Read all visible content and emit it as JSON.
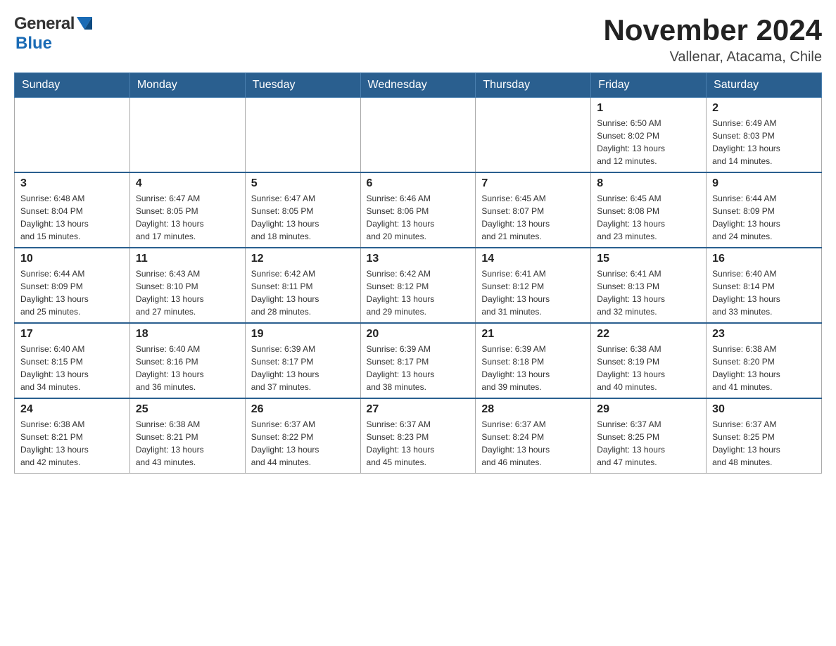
{
  "header": {
    "logo_general": "General",
    "logo_blue": "Blue",
    "title": "November 2024",
    "subtitle": "Vallenar, Atacama, Chile"
  },
  "weekdays": [
    "Sunday",
    "Monday",
    "Tuesday",
    "Wednesday",
    "Thursday",
    "Friday",
    "Saturday"
  ],
  "weeks": [
    [
      {
        "day": "",
        "info": ""
      },
      {
        "day": "",
        "info": ""
      },
      {
        "day": "",
        "info": ""
      },
      {
        "day": "",
        "info": ""
      },
      {
        "day": "",
        "info": ""
      },
      {
        "day": "1",
        "info": "Sunrise: 6:50 AM\nSunset: 8:02 PM\nDaylight: 13 hours\nand 12 minutes."
      },
      {
        "day": "2",
        "info": "Sunrise: 6:49 AM\nSunset: 8:03 PM\nDaylight: 13 hours\nand 14 minutes."
      }
    ],
    [
      {
        "day": "3",
        "info": "Sunrise: 6:48 AM\nSunset: 8:04 PM\nDaylight: 13 hours\nand 15 minutes."
      },
      {
        "day": "4",
        "info": "Sunrise: 6:47 AM\nSunset: 8:05 PM\nDaylight: 13 hours\nand 17 minutes."
      },
      {
        "day": "5",
        "info": "Sunrise: 6:47 AM\nSunset: 8:05 PM\nDaylight: 13 hours\nand 18 minutes."
      },
      {
        "day": "6",
        "info": "Sunrise: 6:46 AM\nSunset: 8:06 PM\nDaylight: 13 hours\nand 20 minutes."
      },
      {
        "day": "7",
        "info": "Sunrise: 6:45 AM\nSunset: 8:07 PM\nDaylight: 13 hours\nand 21 minutes."
      },
      {
        "day": "8",
        "info": "Sunrise: 6:45 AM\nSunset: 8:08 PM\nDaylight: 13 hours\nand 23 minutes."
      },
      {
        "day": "9",
        "info": "Sunrise: 6:44 AM\nSunset: 8:09 PM\nDaylight: 13 hours\nand 24 minutes."
      }
    ],
    [
      {
        "day": "10",
        "info": "Sunrise: 6:44 AM\nSunset: 8:09 PM\nDaylight: 13 hours\nand 25 minutes."
      },
      {
        "day": "11",
        "info": "Sunrise: 6:43 AM\nSunset: 8:10 PM\nDaylight: 13 hours\nand 27 minutes."
      },
      {
        "day": "12",
        "info": "Sunrise: 6:42 AM\nSunset: 8:11 PM\nDaylight: 13 hours\nand 28 minutes."
      },
      {
        "day": "13",
        "info": "Sunrise: 6:42 AM\nSunset: 8:12 PM\nDaylight: 13 hours\nand 29 minutes."
      },
      {
        "day": "14",
        "info": "Sunrise: 6:41 AM\nSunset: 8:12 PM\nDaylight: 13 hours\nand 31 minutes."
      },
      {
        "day": "15",
        "info": "Sunrise: 6:41 AM\nSunset: 8:13 PM\nDaylight: 13 hours\nand 32 minutes."
      },
      {
        "day": "16",
        "info": "Sunrise: 6:40 AM\nSunset: 8:14 PM\nDaylight: 13 hours\nand 33 minutes."
      }
    ],
    [
      {
        "day": "17",
        "info": "Sunrise: 6:40 AM\nSunset: 8:15 PM\nDaylight: 13 hours\nand 34 minutes."
      },
      {
        "day": "18",
        "info": "Sunrise: 6:40 AM\nSunset: 8:16 PM\nDaylight: 13 hours\nand 36 minutes."
      },
      {
        "day": "19",
        "info": "Sunrise: 6:39 AM\nSunset: 8:17 PM\nDaylight: 13 hours\nand 37 minutes."
      },
      {
        "day": "20",
        "info": "Sunrise: 6:39 AM\nSunset: 8:17 PM\nDaylight: 13 hours\nand 38 minutes."
      },
      {
        "day": "21",
        "info": "Sunrise: 6:39 AM\nSunset: 8:18 PM\nDaylight: 13 hours\nand 39 minutes."
      },
      {
        "day": "22",
        "info": "Sunrise: 6:38 AM\nSunset: 8:19 PM\nDaylight: 13 hours\nand 40 minutes."
      },
      {
        "day": "23",
        "info": "Sunrise: 6:38 AM\nSunset: 8:20 PM\nDaylight: 13 hours\nand 41 minutes."
      }
    ],
    [
      {
        "day": "24",
        "info": "Sunrise: 6:38 AM\nSunset: 8:21 PM\nDaylight: 13 hours\nand 42 minutes."
      },
      {
        "day": "25",
        "info": "Sunrise: 6:38 AM\nSunset: 8:21 PM\nDaylight: 13 hours\nand 43 minutes."
      },
      {
        "day": "26",
        "info": "Sunrise: 6:37 AM\nSunset: 8:22 PM\nDaylight: 13 hours\nand 44 minutes."
      },
      {
        "day": "27",
        "info": "Sunrise: 6:37 AM\nSunset: 8:23 PM\nDaylight: 13 hours\nand 45 minutes."
      },
      {
        "day": "28",
        "info": "Sunrise: 6:37 AM\nSunset: 8:24 PM\nDaylight: 13 hours\nand 46 minutes."
      },
      {
        "day": "29",
        "info": "Sunrise: 6:37 AM\nSunset: 8:25 PM\nDaylight: 13 hours\nand 47 minutes."
      },
      {
        "day": "30",
        "info": "Sunrise: 6:37 AM\nSunset: 8:25 PM\nDaylight: 13 hours\nand 48 minutes."
      }
    ]
  ]
}
